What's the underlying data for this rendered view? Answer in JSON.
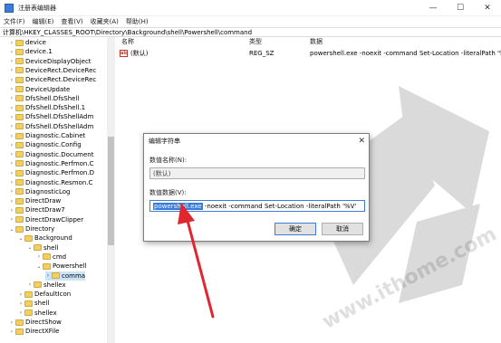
{
  "window": {
    "title": "注册表编辑器",
    "controls": [
      "—",
      "☐",
      "✕"
    ]
  },
  "menu": [
    "文件(F)",
    "编辑(E)",
    "查看(V)",
    "收藏夹(A)",
    "帮助(H)"
  ],
  "address": "计算机\\HKEY_CLASSES_ROOT\\Directory\\Background\\shell\\Powershell\\command",
  "tree": [
    {
      "label": "device",
      "level": 1
    },
    {
      "label": "device.1",
      "level": 1
    },
    {
      "label": "DeviceDisplayObject",
      "level": 1
    },
    {
      "label": "DeviceRect.DeviceRec",
      "level": 1
    },
    {
      "label": "DeviceRect.DeviceRec",
      "level": 1
    },
    {
      "label": "DeviceUpdate",
      "level": 1
    },
    {
      "label": "DfsShell.DfsShell",
      "level": 1
    },
    {
      "label": "DfsShell.DfsShell.1",
      "level": 1
    },
    {
      "label": "DfsShell.DfsShellAdm",
      "level": 1
    },
    {
      "label": "DfsShell.DfsShellAdm",
      "level": 1
    },
    {
      "label": "Diagnostic.Cabinet",
      "level": 1
    },
    {
      "label": "Diagnostic.Config",
      "level": 1
    },
    {
      "label": "Diagnostic.Document",
      "level": 1
    },
    {
      "label": "Diagnostic.Perfmon.C",
      "level": 1
    },
    {
      "label": "Diagnostic.Perfmon.D",
      "level": 1
    },
    {
      "label": "Diagnostic.Resmon.C",
      "level": 1
    },
    {
      "label": "DiagnosticLog",
      "level": 1
    },
    {
      "label": "DirectDraw",
      "level": 1
    },
    {
      "label": "DirectDraw7",
      "level": 1
    },
    {
      "label": "DirectDrawClipper",
      "level": 1
    },
    {
      "label": "Directory",
      "level": 1,
      "expanded": true
    },
    {
      "label": "Background",
      "level": 2,
      "expanded": true
    },
    {
      "label": "shell",
      "level": 3,
      "expanded": true
    },
    {
      "label": "cmd",
      "level": 4
    },
    {
      "label": "Powershell",
      "level": 4,
      "expanded": true
    },
    {
      "label": "comma",
      "level": 5,
      "selected": true
    },
    {
      "label": "shellex",
      "level": 3
    },
    {
      "label": "DefaultIcon",
      "level": 2
    },
    {
      "label": "shell",
      "level": 2
    },
    {
      "label": "shellex",
      "level": 2
    },
    {
      "label": "DirectShow",
      "level": 1
    },
    {
      "label": "DirectXFile",
      "level": 1
    }
  ],
  "list": {
    "headers": {
      "name": "名称",
      "type": "类型",
      "data": "数据"
    },
    "rows": [
      {
        "icon": "ab",
        "name": "(默认)",
        "type": "REG_SZ",
        "data": "powershell.exe -noexit -command Set-Location -literalPath '%V'"
      }
    ]
  },
  "dialog": {
    "title": "编辑字符串",
    "close": "✕",
    "name_label": "数值名称(N):",
    "name_value": "(默认)",
    "data_label": "数值数据(V):",
    "data_selected": "powershell.exe",
    "data_rest": " -noexit -command Set-Location -literalPath '%V'",
    "ok_label": "确定",
    "cancel_label": "取消"
  },
  "watermark": "www.ithome.com",
  "colors": {
    "accent": "#3b7dd8",
    "selection": "#cce4f7",
    "arrow": "#e0262e",
    "folder": "#f3cf5f"
  }
}
